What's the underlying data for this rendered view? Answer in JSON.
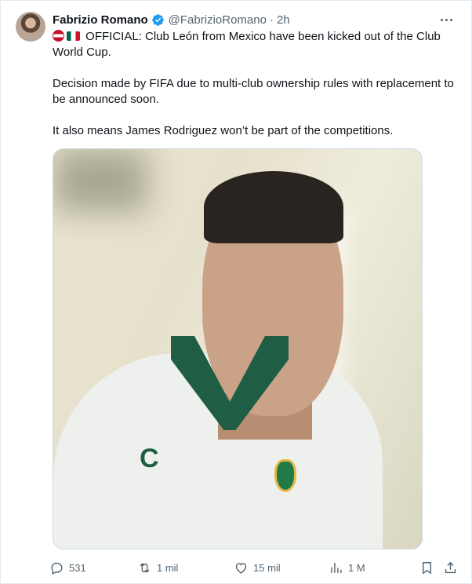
{
  "post": {
    "author_name": "Fabrizio Romano",
    "handle": "@FabrizioRomano",
    "separator": "·",
    "time": "2h",
    "verified_color": "#1d9bf0",
    "lines": [
      "OFFICIAL: Club León from Mexico have been kicked out of the Club World Cup.",
      "Decision made by FIFA due to multi-club ownership rules with replacement to be announced soon.",
      "It also means James Rodriguez won’t be part of the competitions."
    ],
    "flags": [
      "austria-flag-icon",
      "mexico-flag-icon"
    ]
  },
  "actions": {
    "replies": "531",
    "reposts": "1 mil",
    "likes": "15 mil",
    "views": "1 M"
  },
  "icons": {
    "reply": "reply-icon",
    "repost": "repost-icon",
    "like": "like-icon",
    "views": "views-icon",
    "bookmark": "bookmark-icon",
    "share": "share-icon",
    "more": "more-options-icon"
  }
}
